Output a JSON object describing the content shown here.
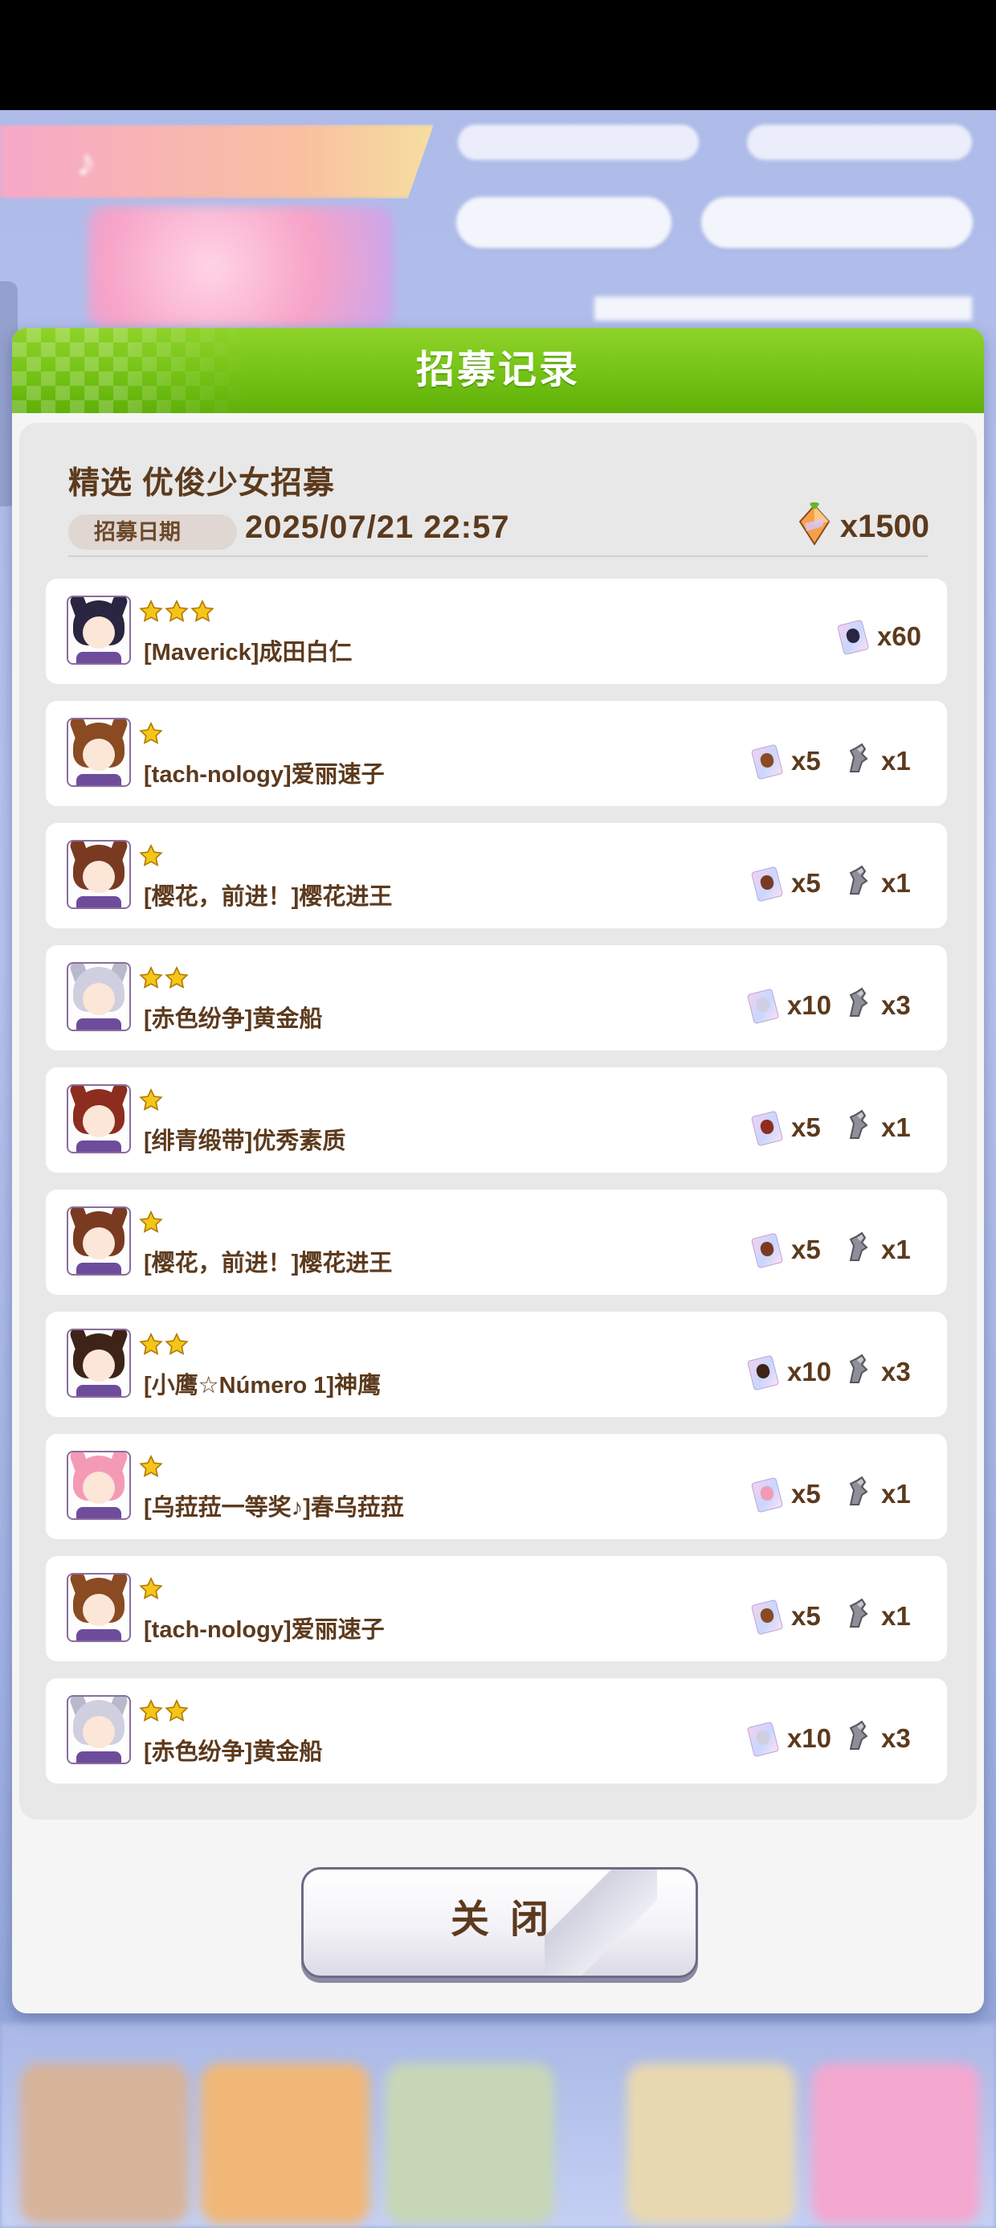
{
  "dialog": {
    "title": "招募记录",
    "gacha_name": "精选  优俊少女招募",
    "date_label": "招募日期",
    "date_value": "2025/07/21  22:57",
    "cost": {
      "icon": "carat-icon",
      "amount": "x1500"
    },
    "close_label": "关闭"
  },
  "records": [
    {
      "stars": 3,
      "name": "[Maverick]成田白仁",
      "portrait": "narita-brian",
      "rewards": [
        {
          "icon": "piece-ticket-icon",
          "amount": "x60"
        }
      ]
    },
    {
      "stars": 1,
      "name": "[tach-nology]爱丽速子",
      "portrait": "agnes-tachyon",
      "rewards": [
        {
          "icon": "piece-ticket-icon",
          "amount": "x5"
        },
        {
          "icon": "goddess-statue-icon",
          "amount": "x1"
        }
      ]
    },
    {
      "stars": 1,
      "name": "[樱花，前进！]樱花进王",
      "portrait": "sakura-shinno-o",
      "rewards": [
        {
          "icon": "piece-ticket-icon",
          "amount": "x5"
        },
        {
          "icon": "goddess-statue-icon",
          "amount": "x1"
        }
      ]
    },
    {
      "stars": 2,
      "name": "[赤色纷争]黄金船",
      "portrait": "gold-ship",
      "rewards": [
        {
          "icon": "piece-ticket-icon",
          "amount": "x10"
        },
        {
          "icon": "goddess-statue-icon",
          "amount": "x3"
        }
      ]
    },
    {
      "stars": 1,
      "name": "[绯青缎带]优秀素质",
      "portrait": "nice-nature",
      "rewards": [
        {
          "icon": "piece-ticket-icon",
          "amount": "x5"
        },
        {
          "icon": "goddess-statue-icon",
          "amount": "x1"
        }
      ]
    },
    {
      "stars": 1,
      "name": "[樱花，前进！]樱花进王",
      "portrait": "sakura-shinno-o",
      "rewards": [
        {
          "icon": "piece-ticket-icon",
          "amount": "x5"
        },
        {
          "icon": "goddess-statue-icon",
          "amount": "x1"
        }
      ]
    },
    {
      "stars": 2,
      "name": "[小鹰☆Número 1]神鹰",
      "portrait": "el-condor-pasa",
      "rewards": [
        {
          "icon": "piece-ticket-icon",
          "amount": "x10"
        },
        {
          "icon": "goddess-statue-icon",
          "amount": "x3"
        }
      ]
    },
    {
      "stars": 1,
      "name": "[乌菈菈一等奖♪]春乌菈菈",
      "portrait": "haru-urara",
      "rewards": [
        {
          "icon": "piece-ticket-icon",
          "amount": "x5"
        },
        {
          "icon": "goddess-statue-icon",
          "amount": "x1"
        }
      ]
    },
    {
      "stars": 1,
      "name": "[tach-nology]爱丽速子",
      "portrait": "agnes-tachyon",
      "rewards": [
        {
          "icon": "piece-ticket-icon",
          "amount": "x5"
        },
        {
          "icon": "goddess-statue-icon",
          "amount": "x1"
        }
      ]
    },
    {
      "stars": 2,
      "name": "[赤色纷争]黄金船",
      "portrait": "gold-ship",
      "rewards": [
        {
          "icon": "piece-ticket-icon",
          "amount": "x10"
        },
        {
          "icon": "goddess-statue-icon",
          "amount": "x3"
        }
      ]
    }
  ],
  "colors": {
    "header_green": "#74c215",
    "text_brown": "#5c3a1d",
    "star_gold": "#f5c518"
  }
}
